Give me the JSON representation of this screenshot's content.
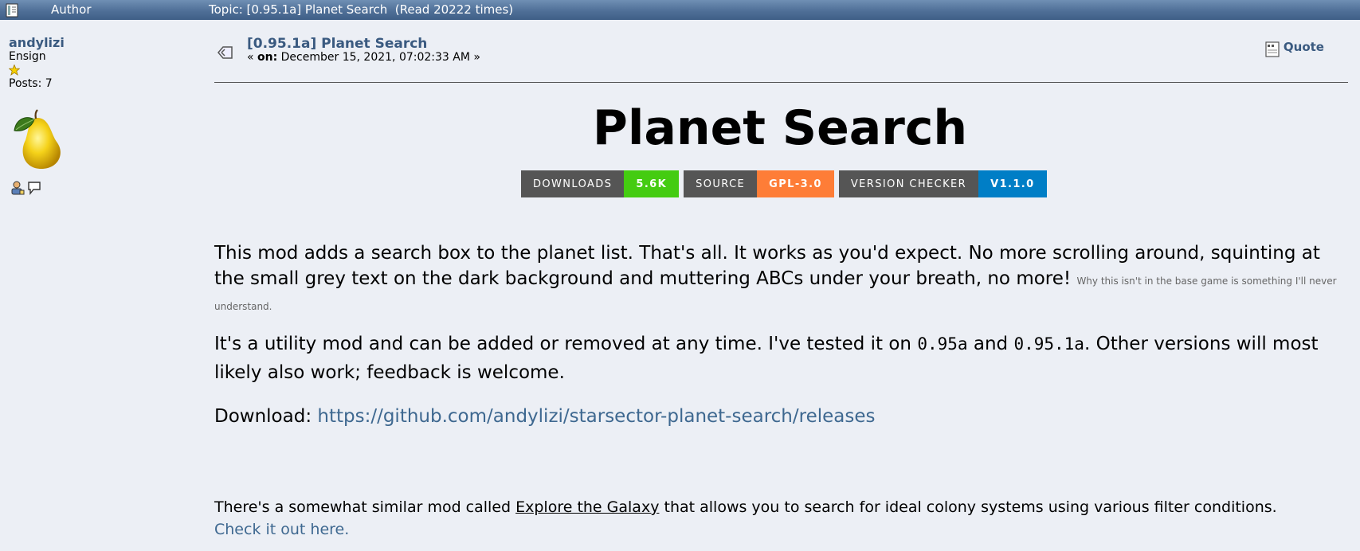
{
  "header": {
    "author_label": "Author",
    "topic_label": "Topic: [0.95.1a] Planet Search  (Read 20222 times)"
  },
  "poster": {
    "username": "andylizi",
    "rank": "Ensign",
    "posts": "Posts: 7",
    "avatar": "pear-avatar"
  },
  "post": {
    "title": "[0.95.1a] Planet Search",
    "date_prefix": "« ",
    "date_on": "on:",
    "date_value": " December 15, 2021, 07:02:33 AM »",
    "quote_label": "Quote"
  },
  "content": {
    "heading": "Planet Search",
    "badges": [
      {
        "label": "DOWNLOADS",
        "value": "5.6K",
        "color": "#44cc11"
      },
      {
        "label": "SOURCE",
        "value": "GPL-3.0",
        "color": "#fe7d37"
      },
      {
        "label": "VERSION CHECKER",
        "value": "V1.1.0",
        "color": "#007ec6"
      }
    ],
    "para1": "This mod adds a search box to the planet list. That's all. It works as you'd expect. No more scrolling around, squinting at the small grey text on the dark background and muttering ABCs under your breath, no more!",
    "para1_small": "Why this isn't in the base game is something I'll never understand.",
    "para2_a": "It's a utility mod and can be added or removed at any time. I've tested it on ",
    "para2_code1": "0.95a",
    "para2_b": " and ",
    "para2_code2": "0.95.1a",
    "para2_c": ". Other versions will most likely also work; feedback is welcome.",
    "download_label": "Download: ",
    "download_url": "https://github.com/andylizi/starsector-planet-search/releases",
    "para4_a": "There's a somewhat similar mod called ",
    "para4_link": "Explore the Galaxy",
    "para4_b": " that allows you to search for ideal colony systems using various filter conditions.",
    "para4_check": "Check it out here."
  }
}
